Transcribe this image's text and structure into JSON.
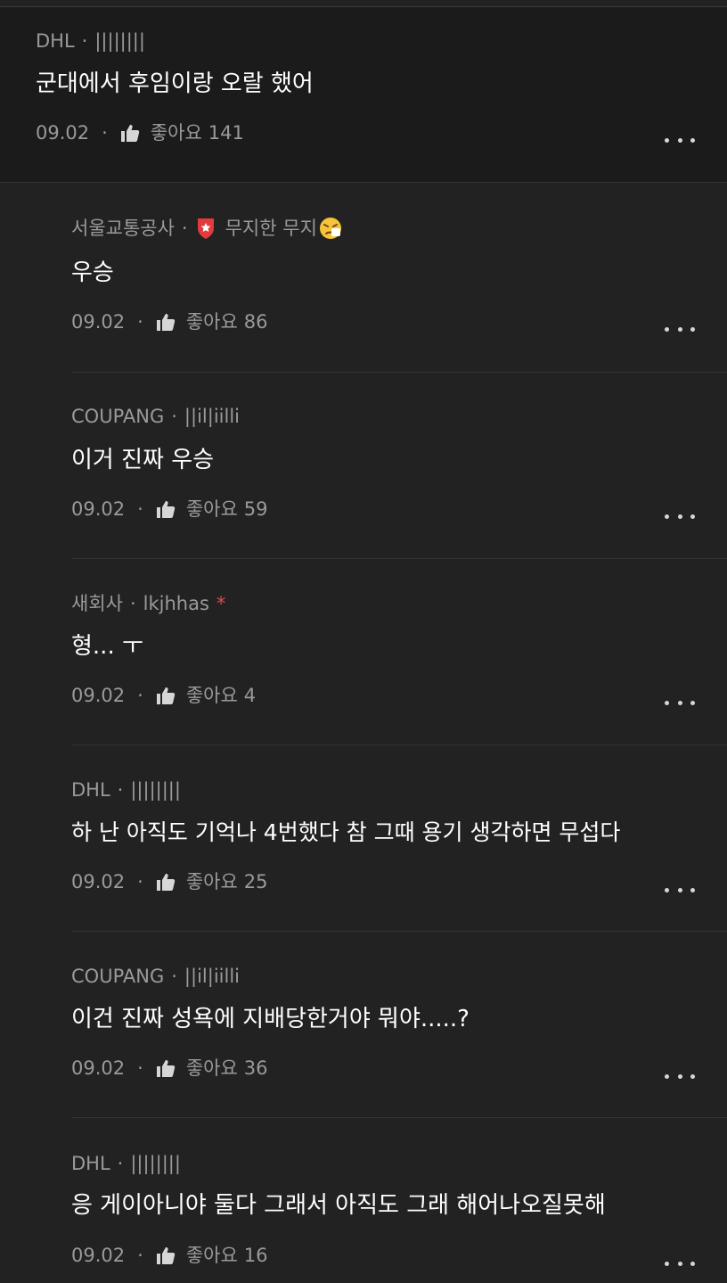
{
  "parent_comment": {
    "company": "DHL",
    "nickname": "||||||||",
    "text": "군대에서 후임이랑 오랄 했어",
    "date": "09.02",
    "like_label": "좋아요",
    "like_count": "141"
  },
  "replies": [
    {
      "company": "서울교통공사",
      "nickname": "무지한 무지",
      "badge_icon": "red-shield-star-icon",
      "nickname_emoji": "sneezing-face-emoji",
      "text": "우승",
      "date": "09.02",
      "like_label": "좋아요",
      "like_count": "86"
    },
    {
      "company": "COUPANG",
      "nickname": "||il|iilli",
      "text": "이거 진짜 우승",
      "date": "09.02",
      "like_label": "좋아요",
      "like_count": "59"
    },
    {
      "company": "새회사",
      "nickname": "lkjhhas",
      "author_mark": "*",
      "text": "형... ㅜ",
      "date": "09.02",
      "like_label": "좋아요",
      "like_count": "4"
    },
    {
      "company": "DHL",
      "nickname": "||||||||",
      "text": "하 난 아직도 기억나 4번했다 참 그때 용기 생각하면 무섭다",
      "date": "09.02",
      "like_label": "좋아요",
      "like_count": "25"
    },
    {
      "company": "COUPANG",
      "nickname": "||il|iilli",
      "text": "이건 진짜 성욕에 지배당한거야 뭐야.....?",
      "date": "09.02",
      "like_label": "좋아요",
      "like_count": "36"
    },
    {
      "company": "DHL",
      "nickname": "||||||||",
      "text": "응 게이아니야 둘다 그래서 아직도 그래 해어나오질못해",
      "date": "09.02",
      "like_label": "좋아요",
      "like_count": "16"
    }
  ],
  "colors": {
    "background": "#222222",
    "parent_background": "#1b1b1b",
    "meta_text": "#9a9a9a",
    "body_text": "#ffffff",
    "author_mark": "#e24a4a",
    "badge_red": "#e23b3b"
  },
  "icons": {
    "like": "thumbs-up-icon",
    "more": "more-options-icon"
  }
}
